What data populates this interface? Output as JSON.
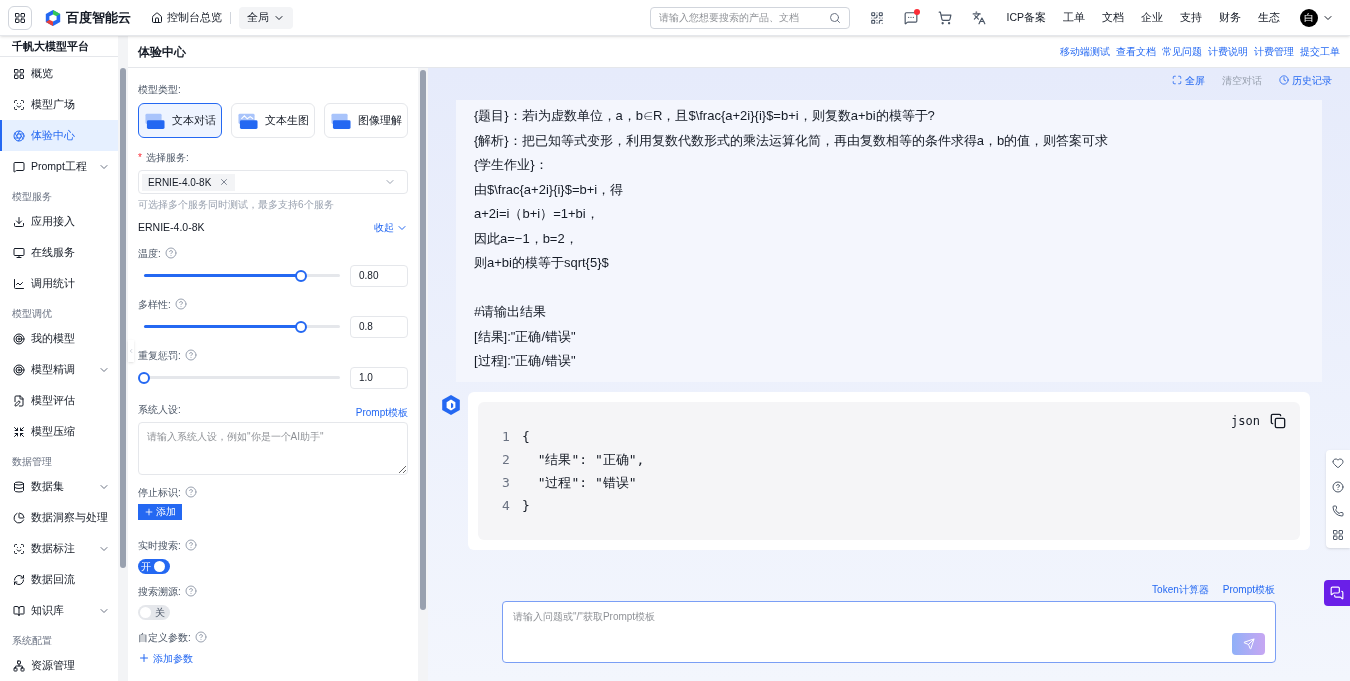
{
  "topbar": {
    "brand": "百度智能云",
    "home": "控制台总览",
    "scope": "全局",
    "search": {
      "placeholder": "请输入您想要搜索的产品、文档"
    },
    "message_dot": true,
    "nav": [
      "ICP备案",
      "工单",
      "文档",
      "企业",
      "支持",
      "财务",
      "生态"
    ],
    "avatar": "白"
  },
  "sidebar": {
    "title": "千帆大模型平台",
    "sections": [
      {
        "items": [
          {
            "label": "概览",
            "selected": false,
            "kind": "link"
          },
          {
            "label": "模型广场",
            "selected": false,
            "kind": "link"
          },
          {
            "label": "体验中心",
            "selected": true,
            "kind": "link"
          },
          {
            "label": "Prompt工程",
            "selected": false,
            "kind": "group",
            "expanded": false
          }
        ]
      },
      {
        "title": "模型服务",
        "items": [
          {
            "label": "应用接入",
            "selected": false,
            "kind": "link"
          },
          {
            "label": "在线服务",
            "selected": false,
            "kind": "link"
          },
          {
            "label": "调用统计",
            "selected": false,
            "kind": "link"
          }
        ]
      },
      {
        "title": "模型调优",
        "items": [
          {
            "label": "我的模型",
            "selected": false,
            "kind": "link"
          },
          {
            "label": "模型精调",
            "selected": false,
            "kind": "group",
            "expanded": false
          },
          {
            "label": "模型评估",
            "selected": false,
            "kind": "link"
          },
          {
            "label": "模型压缩",
            "selected": false,
            "kind": "link"
          }
        ]
      },
      {
        "title": "数据管理",
        "items": [
          {
            "label": "数据集",
            "selected": false,
            "kind": "group",
            "expanded": false
          },
          {
            "label": "数据洞察与处理",
            "selected": false,
            "kind": "link"
          },
          {
            "label": "数据标注",
            "selected": false,
            "kind": "group",
            "expanded": false
          },
          {
            "label": "数据回流",
            "selected": false,
            "kind": "link"
          },
          {
            "label": "知识库",
            "selected": false,
            "kind": "group",
            "expanded": false
          }
        ]
      },
      {
        "title": "系统配置",
        "items": [
          {
            "label": "资源管理",
            "selected": false,
            "kind": "link"
          }
        ]
      }
    ]
  },
  "page": {
    "title": "体验中心",
    "links": [
      "移动端测试",
      "查看文档",
      "常见问题",
      "计费说明",
      "计费管理",
      "提交工单"
    ]
  },
  "config": {
    "model_type_label": "模型类型:",
    "model_types": [
      {
        "label": "文本对话",
        "selected": true
      },
      {
        "label": "文本生图",
        "selected": false
      },
      {
        "label": "图像理解",
        "selected": false
      }
    ],
    "service": {
      "label": "选择服务:",
      "required_mark": "*",
      "tags": [
        "ERNIE-4.0-8K"
      ],
      "hint": "可选择多个服务同时测试，最多支持6个服务"
    },
    "model_name": "ERNIE-4.0-8K",
    "collapse": "收起",
    "params": [
      {
        "label": "温度:",
        "level": 0.8,
        "value": "0.80"
      },
      {
        "label": "多样性:",
        "level": 0.8,
        "value": "0.8"
      },
      {
        "label": "重复惩罚:",
        "level": 0,
        "value": "1.0"
      }
    ],
    "persona": {
      "label": "系统人设:",
      "link": "Prompt模板",
      "placeholder": "请输入系统人设，例如\"你是一个AI助手\""
    },
    "stop": {
      "label": "停止标识:",
      "button": "添加"
    },
    "switches": [
      {
        "label": "实时搜索:",
        "on": true,
        "text": "开"
      },
      {
        "label": "搜索溯源:",
        "on": false,
        "text": "关"
      }
    ],
    "custom": {
      "label": "自定义参数:",
      "button": "添加参数"
    }
  },
  "chat": {
    "tools": [
      {
        "label": "全屏",
        "kind": "expand",
        "disabled": false
      },
      {
        "label": "清空对话",
        "kind": "plain",
        "disabled": true
      },
      {
        "label": "历史记录",
        "kind": "history",
        "disabled": false
      }
    ],
    "user_paragraphs": [
      [
        "{题目}：若i为虚数单位，a，b∈R，且$\\frac{a+2i}{i}$=b+i，则复数a+bi的模等于?",
        "{解析}：把已知等式变形，利用复数代数形式的乘法运算化简，再由复数相等的条件求得a，b的值，则答案可求",
        "{学生作业}：",
        "由$\\frac{a+2i}{i}$=b+i，得",
        "a+2i=i（b+i）=1+bi，",
        "因此a=−1，b=2，",
        "则a+bi的模等于sqrt{5}$"
      ],
      [
        "#请输出结果",
        "[结果]:\"正确/错误\"",
        "[过程]:\"正确/错误\""
      ]
    ],
    "code": {
      "language": "json",
      "lines": [
        {
          "number": "1",
          "text": "{"
        },
        {
          "number": "2",
          "text": "  \"结果\": \"正确\","
        },
        {
          "number": "3",
          "text": "  \"过程\": \"错误\""
        },
        {
          "number": "4",
          "text": "}"
        }
      ]
    },
    "input_links": [
      "Token计算器",
      "Prompt模板"
    ],
    "input": {
      "placeholder": "请输入问题或\"/\"获取Prompt模板"
    }
  }
}
